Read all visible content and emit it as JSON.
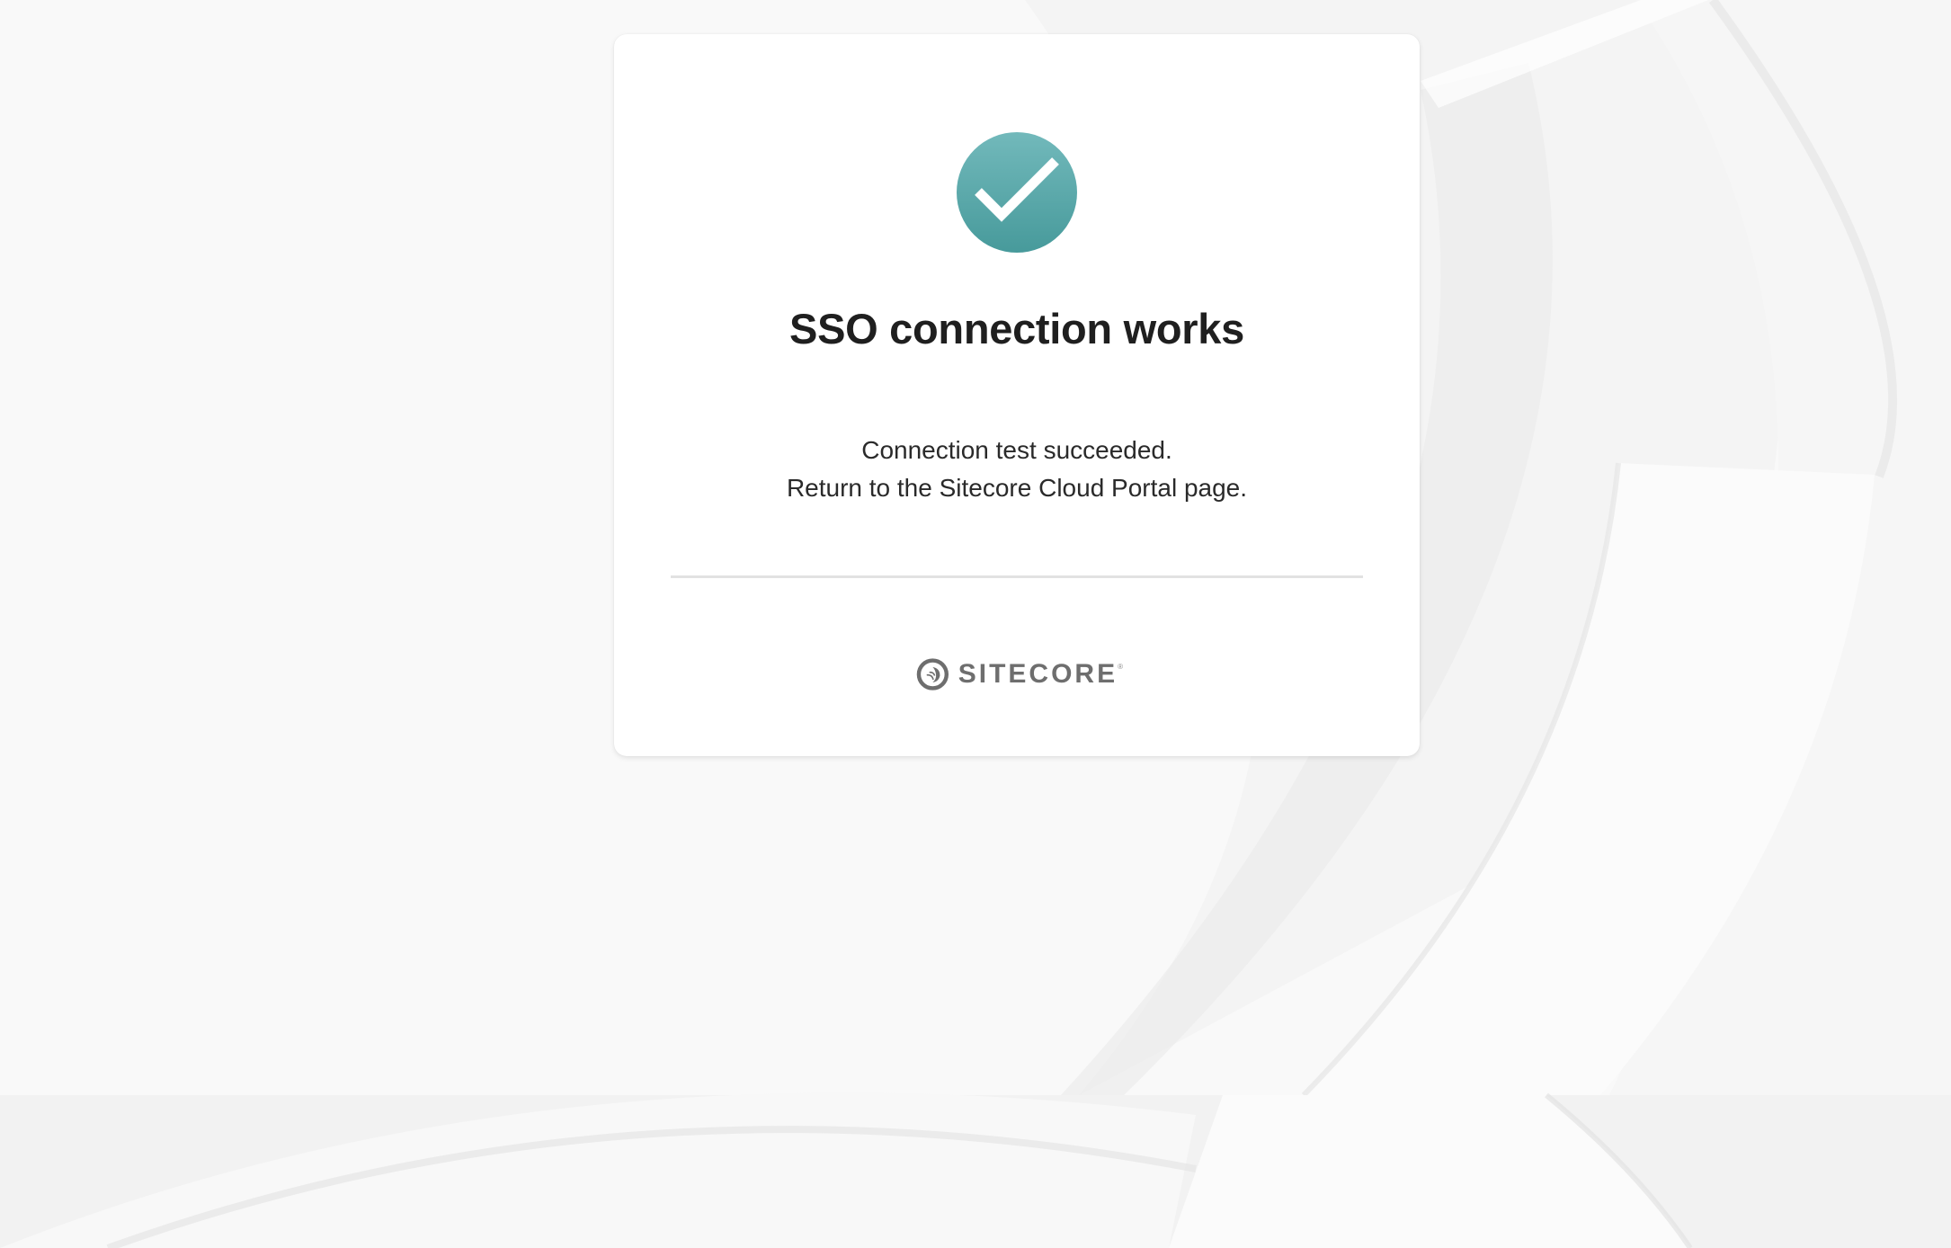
{
  "status": {
    "icon": "checkmark-circle-icon",
    "title": "SSO connection works",
    "message_line1": "Connection test succeeded.",
    "message_line2": "Return to the Sitecore Cloud Portal page."
  },
  "brand": {
    "logo_icon": "sitecore-logo-icon",
    "name": "SITECORE",
    "trademark": "®"
  },
  "colors": {
    "accent_top": "#72b9bb",
    "accent_bottom": "#479a9b",
    "background": "#f8f8f8",
    "card": "#ffffff"
  }
}
